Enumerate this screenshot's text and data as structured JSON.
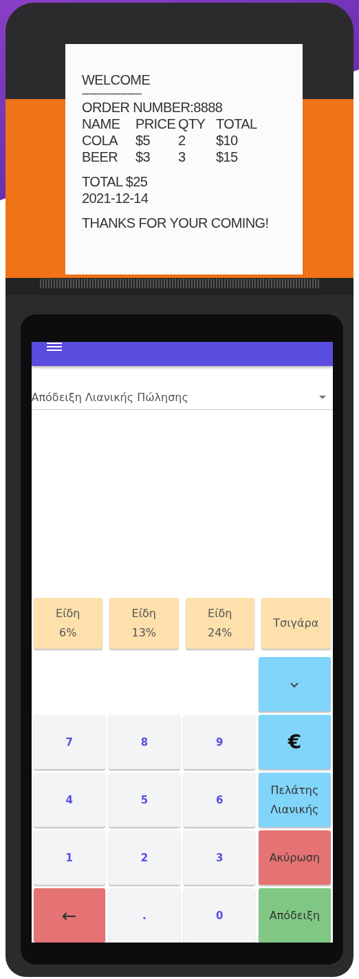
{
  "receipt": {
    "title": "WELCOME",
    "separator": "--------------------",
    "order_number": "ORDER NUMBER:8888",
    "columns": [
      "NAME",
      "PRICE",
      "QTY",
      "TOTAL"
    ],
    "items": [
      {
        "name": "COLA",
        "price": "$5",
        "qty": "2",
        "total": "$10"
      },
      {
        "name": "BEER",
        "price": "$3",
        "qty": "3",
        "total": "$15"
      }
    ],
    "total": "TOTAL $25",
    "date": "2021-12-14",
    "thanks": "THANKS FOR YOUR COMING!"
  },
  "app": {
    "document_type": "Απόδειξη Λιανικής Πώλησης",
    "categories": [
      {
        "label": "Είδη\n6%"
      },
      {
        "label": "Είδη\n13%"
      },
      {
        "label": "Είδη\n24%"
      },
      {
        "label": "Τσιγάρα"
      }
    ],
    "key_rows": [
      [
        {
          "kind": "expand"
        }
      ],
      [
        {
          "kind": "digit",
          "label": "7"
        },
        {
          "kind": "digit",
          "label": "8"
        },
        {
          "kind": "digit",
          "label": "9"
        },
        {
          "kind": "currency",
          "label": "€"
        }
      ],
      [
        {
          "kind": "digit",
          "label": "4"
        },
        {
          "kind": "digit",
          "label": "5"
        },
        {
          "kind": "digit",
          "label": "6"
        },
        {
          "kind": "customer",
          "label": "Πελάτης Λιανικής"
        }
      ],
      [
        {
          "kind": "digit",
          "label": "1"
        },
        {
          "kind": "digit",
          "label": "2"
        },
        {
          "kind": "digit",
          "label": "3"
        },
        {
          "kind": "cancel",
          "label": "Ακύρωση"
        }
      ],
      [
        {
          "kind": "backspace",
          "label": "←"
        },
        {
          "kind": "digit",
          "label": "."
        },
        {
          "kind": "digit",
          "label": "0"
        },
        {
          "kind": "receipt",
          "label": "Απόδειξη"
        }
      ]
    ]
  }
}
